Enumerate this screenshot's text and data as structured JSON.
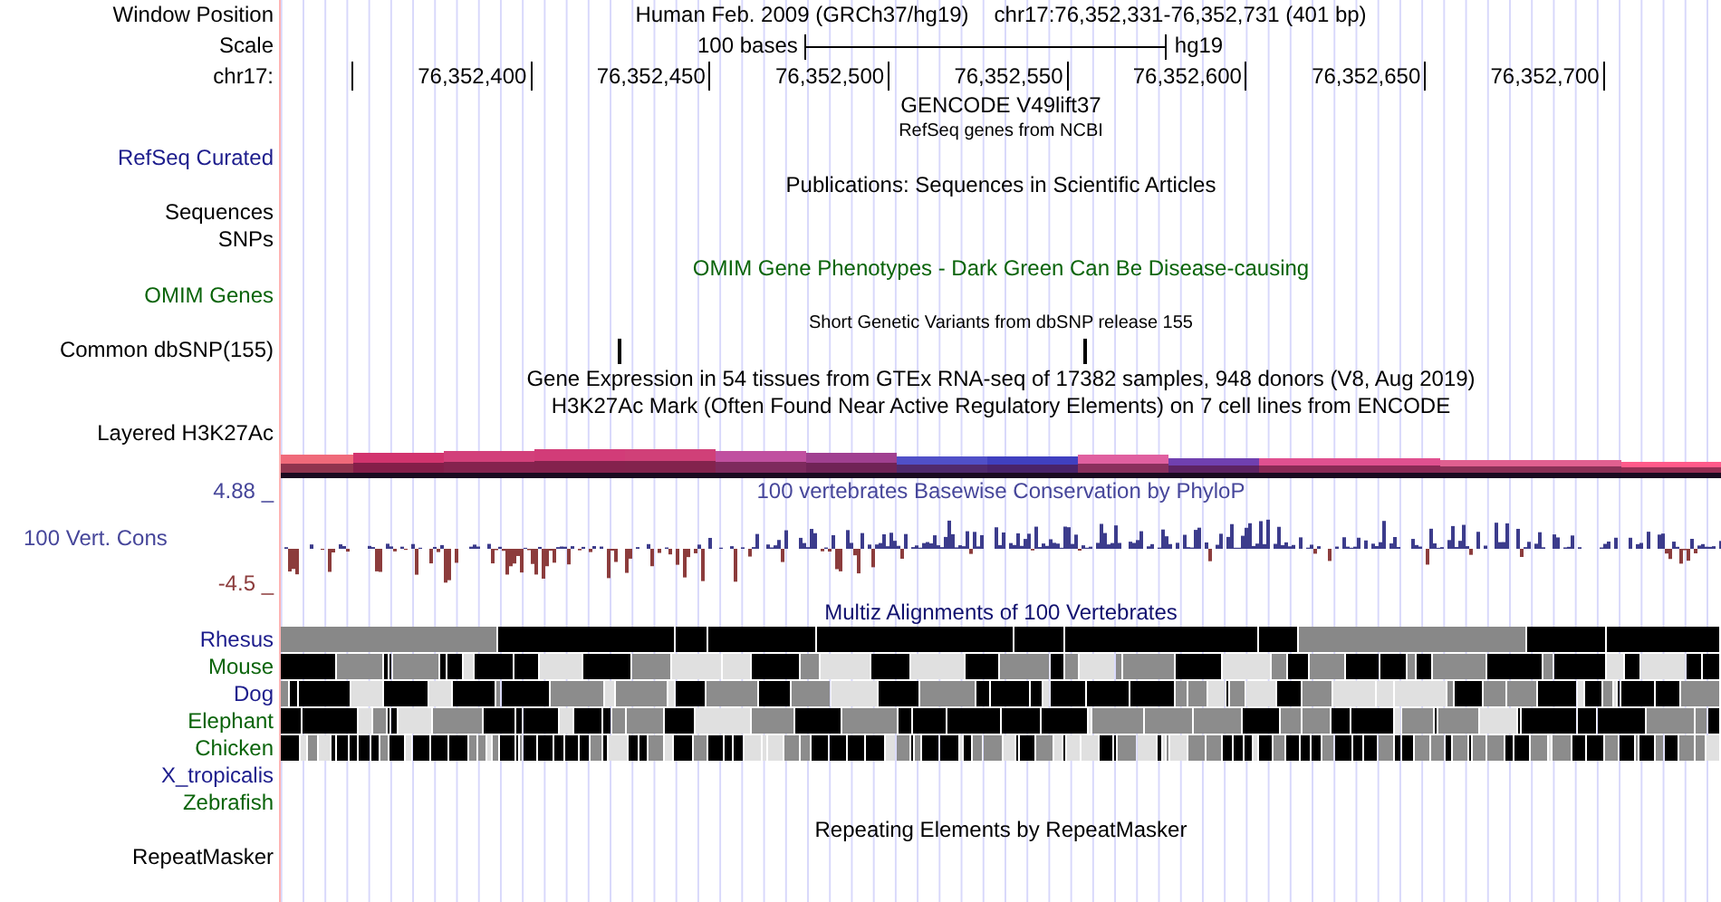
{
  "position": {
    "label": "Window Position",
    "assembly": "Human Feb. 2009 (GRCh37/hg19)",
    "range": "chr17:76,352,331-76,352,731 (401 bp)"
  },
  "scale": {
    "label": "Scale",
    "length": "100 bases",
    "assembly": "hg19"
  },
  "ruler": {
    "label": "chr17:",
    "ticks": [
      "76,352,400",
      "76,352,450",
      "76,352,500",
      "76,352,550",
      "76,352,600",
      "76,352,650",
      "76,352,700"
    ]
  },
  "tracks": [
    {
      "kind": "gene",
      "title": {
        "text": "GENCODE V49lift37",
        "color": "#000000"
      }
    },
    {
      "kind": "refseq",
      "title": {
        "text": "RefSeq genes from NCBI",
        "color": "#000000"
      },
      "labels": [
        "RefSeq Curated"
      ],
      "color": "#1c1c8c"
    },
    {
      "kind": "publications",
      "title": {
        "text": "Publications: Sequences in Scientific Articles",
        "color": "#000000"
      },
      "labels": [
        "Sequences",
        "SNPs"
      ],
      "color": "#000000"
    },
    {
      "kind": "omim",
      "title": {
        "text": "OMIM Gene Phenotypes - Dark Green Can Be Disease-causing",
        "color": "#0a640a"
      },
      "labels": [
        "OMIM Genes"
      ],
      "color": "#0a640a"
    },
    {
      "kind": "snp",
      "title": {
        "text": "Short Genetic Variants from dbSNP release 155",
        "color": "#000000"
      },
      "labels": [
        "Common dbSNP(155)"
      ],
      "color": "#000000"
    },
    {
      "kind": "expression",
      "title": {
        "text": "Gene Expression in 54 tissues from GTEx RNA-seq of 17382 samples, 948 donors (V8, Aug 2019)",
        "color": "#000000"
      }
    },
    {
      "kind": "layered",
      "title": {
        "text": "H3K27Ac Mark (Often Found Near Active Regulatory Elements) on 7 cell lines from ENCODE",
        "color": "#000000"
      },
      "labels": [
        "Layered H3K27Ac"
      ],
      "color": "#000000"
    },
    {
      "kind": "wiggle",
      "title": {
        "text": "100 vertebrates Basewise Conservation by PhyloP",
        "color": "#46469a"
      },
      "labels": [
        "100 Vert. Cons"
      ],
      "color": "#46469a",
      "max": "4.88 _",
      "min": "-4.5 _"
    },
    {
      "kind": "multiz",
      "title": {
        "text": "Multiz Alignments of 100 Vertebrates",
        "color": "#10106e"
      },
      "species": [
        {
          "name": "Rhesus",
          "color": "#1c1c8c",
          "aligned": true
        },
        {
          "name": "Mouse",
          "color": "#0a640a",
          "aligned": true
        },
        {
          "name": "Dog",
          "color": "#1c1c8c",
          "aligned": true
        },
        {
          "name": "Elephant",
          "color": "#0a640a",
          "aligned": true
        },
        {
          "name": "Chicken",
          "color": "#0a640a",
          "aligned": true
        },
        {
          "name": "X_tropicalis",
          "color": "#1c1c8c",
          "aligned": false
        },
        {
          "name": "Zebrafish",
          "color": "#0a640a",
          "aligned": false
        }
      ]
    },
    {
      "kind": "repeats",
      "title": {
        "text": "Repeating Elements by RepeatMasker",
        "color": "#000000"
      },
      "labels": [
        "RepeatMasker"
      ],
      "color": "#000000"
    }
  ]
}
